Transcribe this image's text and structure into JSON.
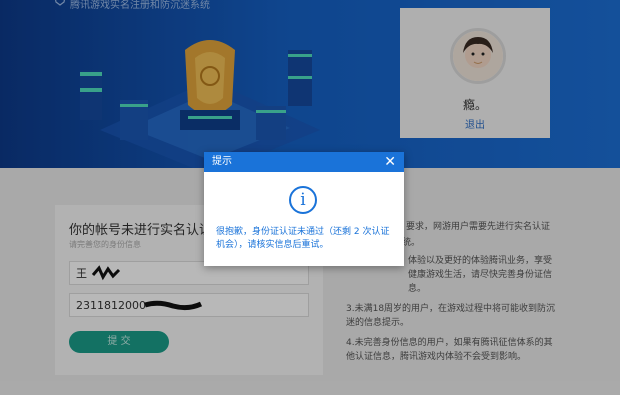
{
  "header": {
    "site_title": "腾讯游戏实名注册和防沉迷系统"
  },
  "user": {
    "name": "瘾。",
    "logout_label": "退出"
  },
  "form": {
    "title": "你的帐号未进行实名认证",
    "subtitle": "请完善您的身份信息",
    "name_value": "王",
    "id_value": "2311812000",
    "submit_label": "提 交"
  },
  "notes": {
    "line1_tail": "要求，网游用户需要先进行实名认证",
    "line1_tail2": "统。",
    "items": [
      "体验以及更好的体验腾讯业务，享受健康游戏生活，请尽快完善身份证信息。",
      "3.未满18周岁的用户，在游戏过程中将可能收到防沉迷的信息提示。",
      "4.未完善身份信息的用户，如果有腾讯征信体系的其他认证信息，腾讯游戏内体验不会受到影响。"
    ]
  },
  "dialog": {
    "title": "提示",
    "close_symbol": "✕",
    "icon_glyph": "i",
    "message": "很抱歉，身份证认证未通过（还剩 2 次认证机会），请核实信息后重试。"
  },
  "colors": {
    "banner": "#1560c4",
    "accent": "#1a73d9",
    "submit": "#1b9d8a"
  }
}
